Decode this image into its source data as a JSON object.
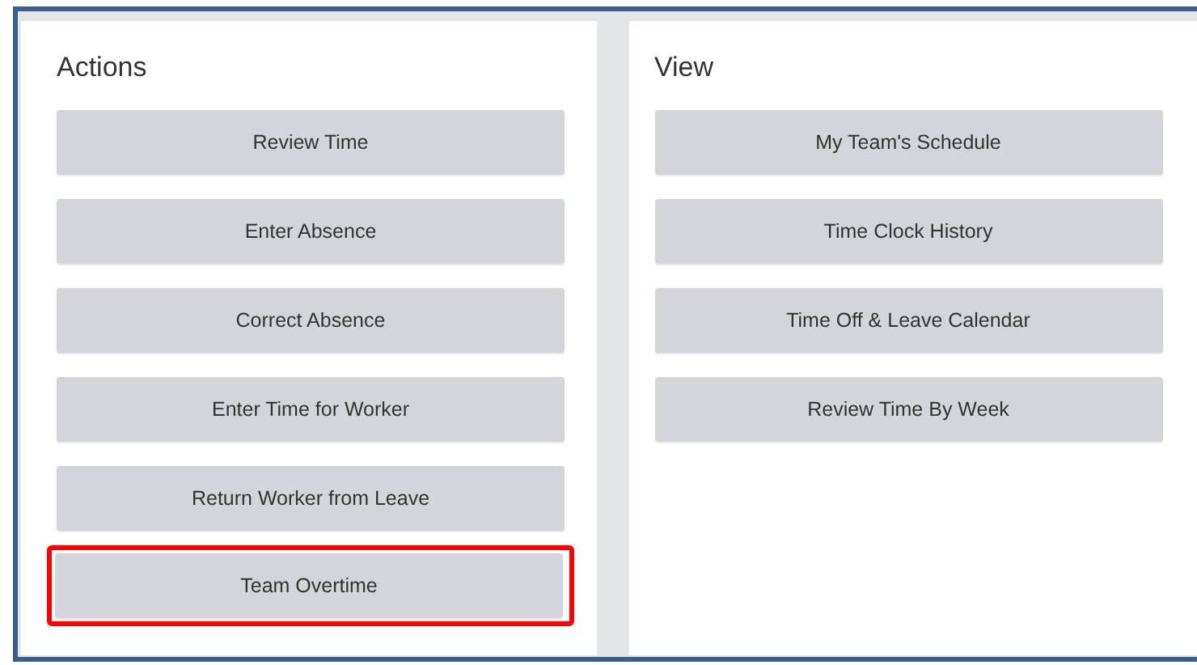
{
  "panels": [
    {
      "title": "Actions",
      "buttons": [
        {
          "label": "Review Time",
          "highlighted": false
        },
        {
          "label": "Enter Absence",
          "highlighted": false
        },
        {
          "label": "Correct Absence",
          "highlighted": false
        },
        {
          "label": "Enter Time for Worker",
          "highlighted": false
        },
        {
          "label": "Return Worker from Leave",
          "highlighted": false
        },
        {
          "label": "Team Overtime",
          "highlighted": true
        }
      ]
    },
    {
      "title": "View",
      "buttons": [
        {
          "label": "My Team's Schedule",
          "highlighted": false
        },
        {
          "label": "Time Clock History",
          "highlighted": false
        },
        {
          "label": "Time Off & Leave Calendar",
          "highlighted": false
        },
        {
          "label": "Review Time By Week",
          "highlighted": false
        }
      ]
    }
  ]
}
